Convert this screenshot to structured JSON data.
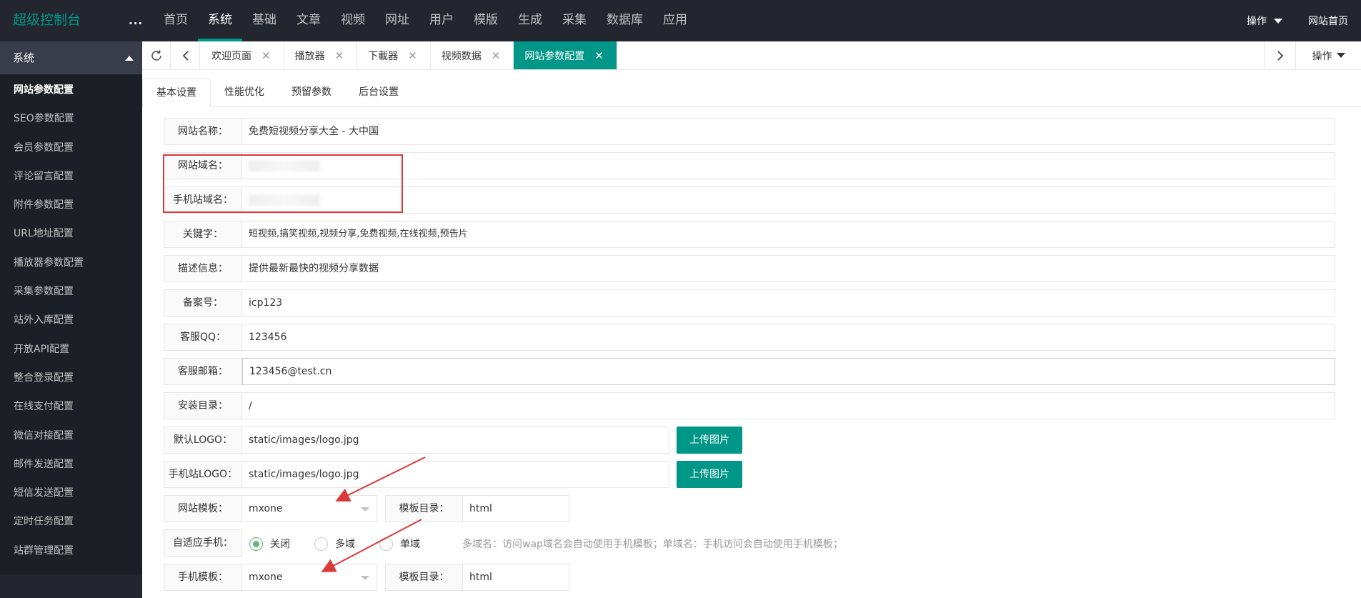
{
  "app": {
    "title": "超级控制台",
    "more": "..."
  },
  "topnav": [
    {
      "label": "首页"
    },
    {
      "label": "系统"
    },
    {
      "label": "基础"
    },
    {
      "label": "文章"
    },
    {
      "label": "视频"
    },
    {
      "label": "网址"
    },
    {
      "label": "用户"
    },
    {
      "label": "模版"
    },
    {
      "label": "生成"
    },
    {
      "label": "采集"
    },
    {
      "label": "数据库"
    },
    {
      "label": "应用"
    }
  ],
  "topnav_active": "系统",
  "topright": {
    "operate": "操作",
    "site_home": "网站首页"
  },
  "sidebar": {
    "header": "系统",
    "items": [
      {
        "label": "网站参数配置"
      },
      {
        "label": "SEO参数配置"
      },
      {
        "label": "会员参数配置"
      },
      {
        "label": "评论留言配置"
      },
      {
        "label": "附件参数配置"
      },
      {
        "label": "URL地址配置"
      },
      {
        "label": "播放器参数配置"
      },
      {
        "label": "采集参数配置"
      },
      {
        "label": "站外入库配置"
      },
      {
        "label": "开放API配置"
      },
      {
        "label": "整合登录配置"
      },
      {
        "label": "在线支付配置"
      },
      {
        "label": "微信对接配置"
      },
      {
        "label": "邮件发送配置"
      },
      {
        "label": "短信发送配置"
      },
      {
        "label": "定时任务配置"
      },
      {
        "label": "站群管理配置"
      }
    ]
  },
  "tabs": [
    {
      "label": "欢迎页面"
    },
    {
      "label": "播放器"
    },
    {
      "label": "下載器"
    },
    {
      "label": "视频数据"
    },
    {
      "label": "网站参数配置"
    }
  ],
  "tabs_operate": "操作",
  "subtabs": [
    {
      "label": "基本设置"
    },
    {
      "label": "性能优化"
    },
    {
      "label": "预留参数"
    },
    {
      "label": "后台设置"
    }
  ],
  "form": {
    "site_name": {
      "label": "网站名称：",
      "value": "免费短视频分享大全 - 大中国"
    },
    "site_domain": {
      "label": "网站域名：",
      "value": ""
    },
    "mobile_domain": {
      "label": "手机站域名：",
      "value": ""
    },
    "keywords": {
      "label": "关键字：",
      "value": "短视频,搞笑视频,视频分享,免费视频,在线视频,预告片"
    },
    "description": {
      "label": "描述信息：",
      "value": "提供最新最快的视频分享数据"
    },
    "icp": {
      "label": "备案号：",
      "value": "icp123"
    },
    "qq": {
      "label": "客服QQ：",
      "value": "123456"
    },
    "email": {
      "label": "客服邮箱：",
      "value": "123456@test.cn"
    },
    "install_dir": {
      "label": "安装目录：",
      "value": "/"
    },
    "logo": {
      "label": "默认LOGO：",
      "value": "static/images/logo.jpg",
      "button": "上传图片"
    },
    "mobile_logo": {
      "label": "手机站LOGO：",
      "value": "static/images/logo.jpg",
      "button": "上传图片"
    },
    "site_template": {
      "label": "网站模板：",
      "value": "mxone",
      "dir_label": "模板目录：",
      "dir_value": "html"
    },
    "adaptive_mobile": {
      "label": "自适应手机：",
      "options": [
        "关闭",
        "多域",
        "单域"
      ],
      "selected": "关闭",
      "hint": "多域名：访问wap域名会自动使用手机模板；单域名：手机访问会自动使用手机模板；"
    },
    "mobile_template": {
      "label": "手机模板：",
      "value": "mxone",
      "dir_label": "模板目录：",
      "dir_value": "html"
    }
  },
  "colors": {
    "accent": "#009688",
    "topbar": "#23262e",
    "annotation": "#d93a3a"
  }
}
